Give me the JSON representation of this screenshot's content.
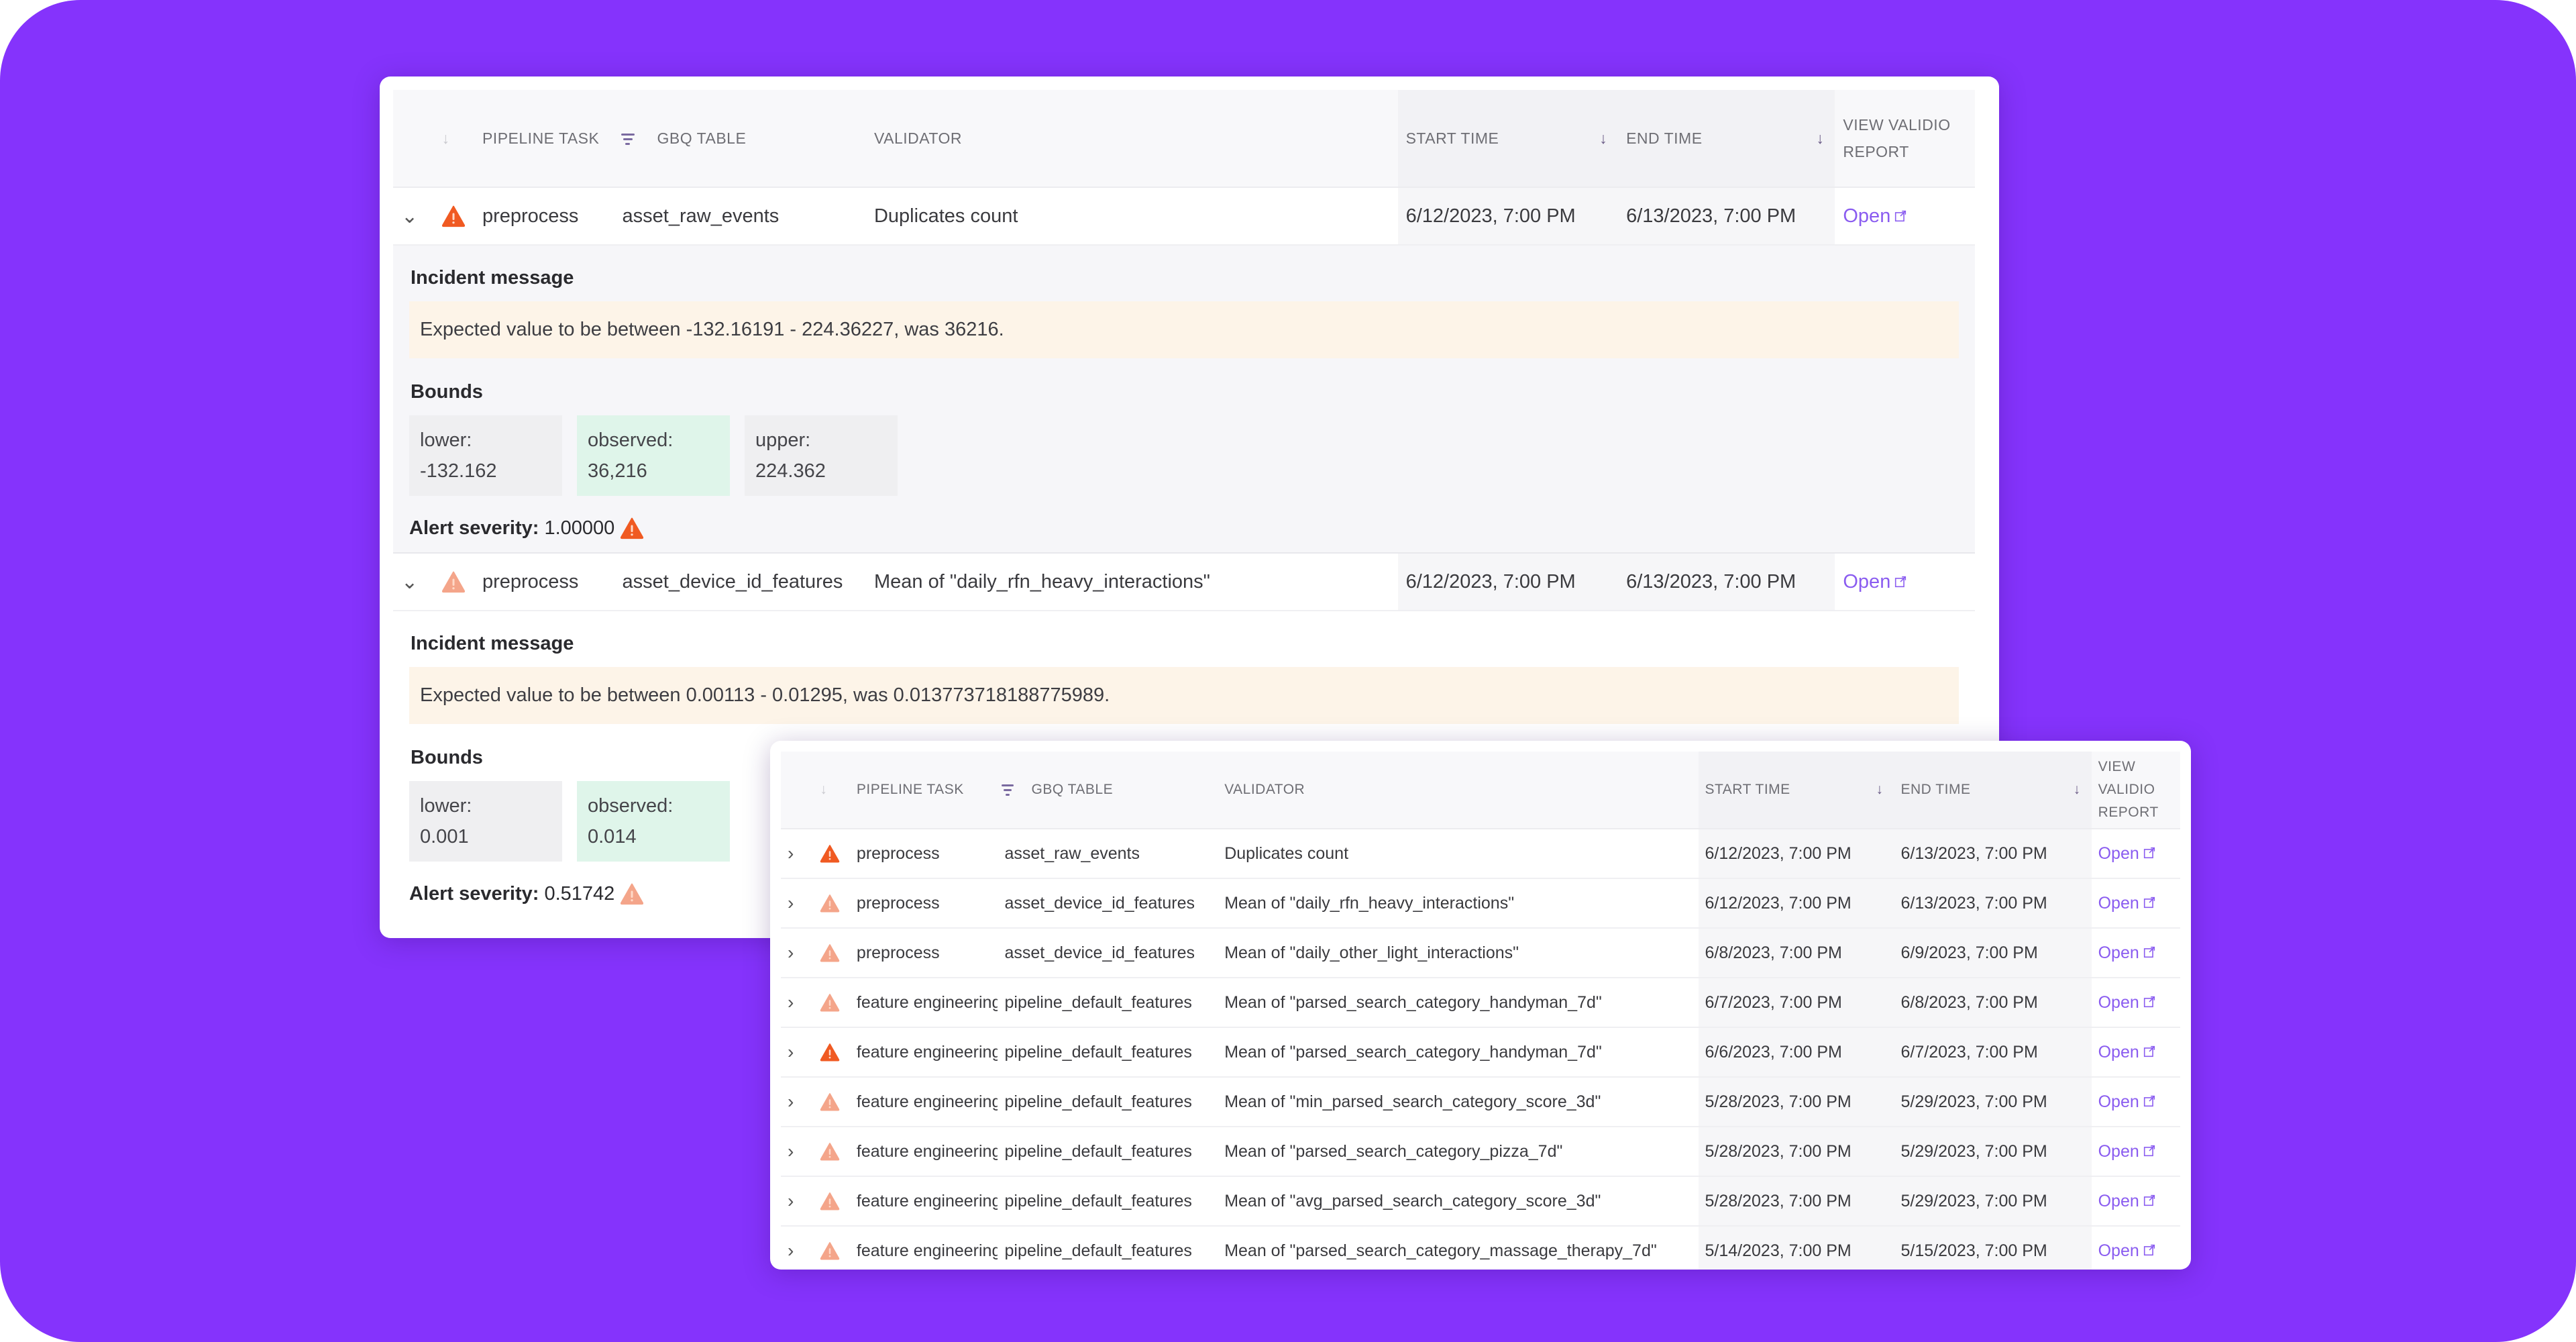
{
  "colors": {
    "background": "#8533fc",
    "alert_high": "#f05a22",
    "alert_medium": "#f4a58a",
    "link": "#8a5cf0",
    "message_bg": "#fdf4e8",
    "observed_bg": "#dff5ea"
  },
  "columns": {
    "pipeline_task": "PIPELINE TASK",
    "gbq_table": "GBQ TABLE",
    "validator": "VALIDATOR",
    "start_time": "START TIME",
    "end_time": "END TIME",
    "view_report_line1": "VIEW VALIDIO",
    "view_report_line2": "REPORT"
  },
  "icons": {
    "expanded": "chevron-down-icon",
    "collapsed": "chevron-right-icon",
    "warning": "warning-triangle-icon",
    "sort": "arrow-down-icon",
    "filter": "filter-icon",
    "external": "external-link-icon"
  },
  "detail_labels": {
    "incident_message": "Incident message",
    "bounds": "Bounds",
    "lower": "lower:",
    "observed": "observed:",
    "upper": "upper:",
    "alert_severity": "Alert severity:"
  },
  "expanded_view": {
    "rows": [
      {
        "severity": "high",
        "pipeline_task": "preprocess",
        "gbq_table": "asset_raw_events",
        "validator": "Duplicates count",
        "start_time": "6/12/2023, 7:00 PM",
        "end_time": "6/13/2023, 7:00 PM",
        "link": "Open",
        "incident_message": "Expected value to be between -132.16191 - 224.36227, was 36216.",
        "bounds": {
          "lower": "-132.162",
          "observed": "36,216",
          "upper": "224.362"
        },
        "alert_severity": "1.00000"
      },
      {
        "severity": "medium",
        "pipeline_task": "preprocess",
        "gbq_table": "asset_device_id_features",
        "validator": "Mean of \"daily_rfn_heavy_interactions\"",
        "start_time": "6/12/2023, 7:00 PM",
        "end_time": "6/13/2023, 7:00 PM",
        "link": "Open",
        "incident_message": "Expected value to be between 0.00113 - 0.01295, was 0.013773718188775989.",
        "bounds": {
          "lower": "0.001",
          "observed": "0.014"
        },
        "alert_severity": "0.51742"
      }
    ]
  },
  "list_view": {
    "rows": [
      {
        "severity": "high",
        "pipeline_task": "preprocess",
        "gbq_table": "asset_raw_events",
        "validator": "Duplicates count",
        "start_time": "6/12/2023, 7:00 PM",
        "end_time": "6/13/2023, 7:00 PM",
        "link": "Open"
      },
      {
        "severity": "medium",
        "pipeline_task": "preprocess",
        "gbq_table": "asset_device_id_features",
        "validator": "Mean of \"daily_rfn_heavy_interactions\"",
        "start_time": "6/12/2023, 7:00 PM",
        "end_time": "6/13/2023, 7:00 PM",
        "link": "Open"
      },
      {
        "severity": "medium",
        "pipeline_task": "preprocess",
        "gbq_table": "asset_device_id_features",
        "validator": "Mean of \"daily_other_light_interactions\"",
        "start_time": "6/8/2023, 7:00 PM",
        "end_time": "6/9/2023, 7:00 PM",
        "link": "Open"
      },
      {
        "severity": "medium",
        "pipeline_task": "feature engineering",
        "gbq_table": "pipeline_default_features",
        "validator": "Mean of \"parsed_search_category_handyman_7d\"",
        "start_time": "6/7/2023, 7:00 PM",
        "end_time": "6/8/2023, 7:00 PM",
        "link": "Open"
      },
      {
        "severity": "high",
        "pipeline_task": "feature engineering",
        "gbq_table": "pipeline_default_features",
        "validator": "Mean of \"parsed_search_category_handyman_7d\"",
        "start_time": "6/6/2023, 7:00 PM",
        "end_time": "6/7/2023, 7:00 PM",
        "link": "Open"
      },
      {
        "severity": "medium",
        "pipeline_task": "feature engineering",
        "gbq_table": "pipeline_default_features",
        "validator": "Mean of \"min_parsed_search_category_score_3d\"",
        "start_time": "5/28/2023, 7:00 PM",
        "end_time": "5/29/2023, 7:00 PM",
        "link": "Open"
      },
      {
        "severity": "medium",
        "pipeline_task": "feature engineering",
        "gbq_table": "pipeline_default_features",
        "validator": "Mean of \"parsed_search_category_pizza_7d\"",
        "start_time": "5/28/2023, 7:00 PM",
        "end_time": "5/29/2023, 7:00 PM",
        "link": "Open"
      },
      {
        "severity": "medium",
        "pipeline_task": "feature engineering",
        "gbq_table": "pipeline_default_features",
        "validator": "Mean of \"avg_parsed_search_category_score_3d\"",
        "start_time": "5/28/2023, 7:00 PM",
        "end_time": "5/29/2023, 7:00 PM",
        "link": "Open"
      },
      {
        "severity": "medium",
        "pipeline_task": "feature engineering",
        "gbq_table": "pipeline_default_features",
        "validator": "Mean of \"parsed_search_category_massage_therapy_7d\"",
        "start_time": "5/14/2023, 7:00 PM",
        "end_time": "5/15/2023, 7:00 PM",
        "link": "Open"
      }
    ]
  }
}
